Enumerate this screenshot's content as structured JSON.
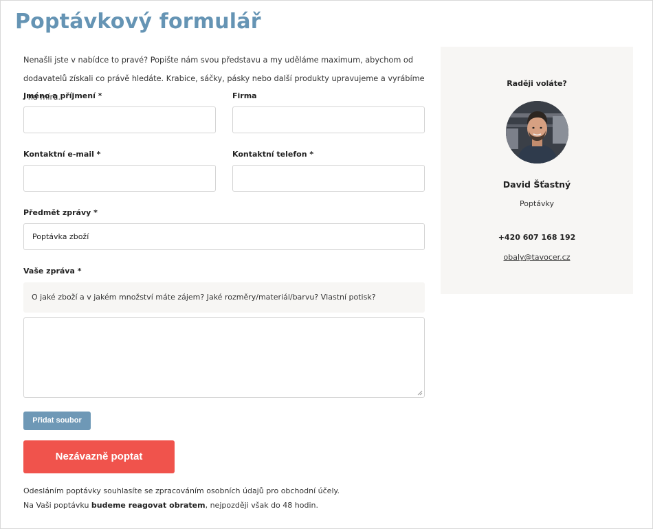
{
  "page": {
    "title": "Poptávkový formulář",
    "intro": "Nenašli jste v nabídce to pravé? Popište nám svou představu a my uděláme maximum, abychom od dodavatelů získali co právě hledáte. Krabice, sáčky, pásky nebo další produkty upravujeme a vyrábíme i na míru."
  },
  "form": {
    "name_label": "Jméno a příjmení *",
    "company_label": "Firma",
    "email_label": "Kontaktní e-mail *",
    "phone_label": "Kontaktní telefon *",
    "subject_label": "Předmět zprávy *",
    "subject_value": "Poptávka zboží",
    "message_label": "Vaše zpráva *",
    "message_hint": "O jaké zboží a v jakém množství máte zájem? Jaké rozměry/materiál/barvu? Vlastní potisk?",
    "add_file_label": "Přidat soubor",
    "submit_label": "Nezávazně poptat",
    "consent": "Odesláním poptávky souhlasíte se zpracováním osobních údajů pro obchodní účely.",
    "response_prefix": "Na Vaši poptávku ",
    "response_bold": "budeme reagovat obratem",
    "response_suffix": ", nejpozději však do 48 hodin."
  },
  "contact": {
    "heading": "Raději voláte?",
    "name": "David Šťastný",
    "role": "Poptávky",
    "phone": "+420 607 168 192",
    "email": "obaly@tavocer.cz"
  },
  "colors": {
    "title": "#6594b4",
    "add_file_button": "#6e98b6",
    "submit_button": "#f0534c",
    "card_background": "#f7f6f4"
  }
}
